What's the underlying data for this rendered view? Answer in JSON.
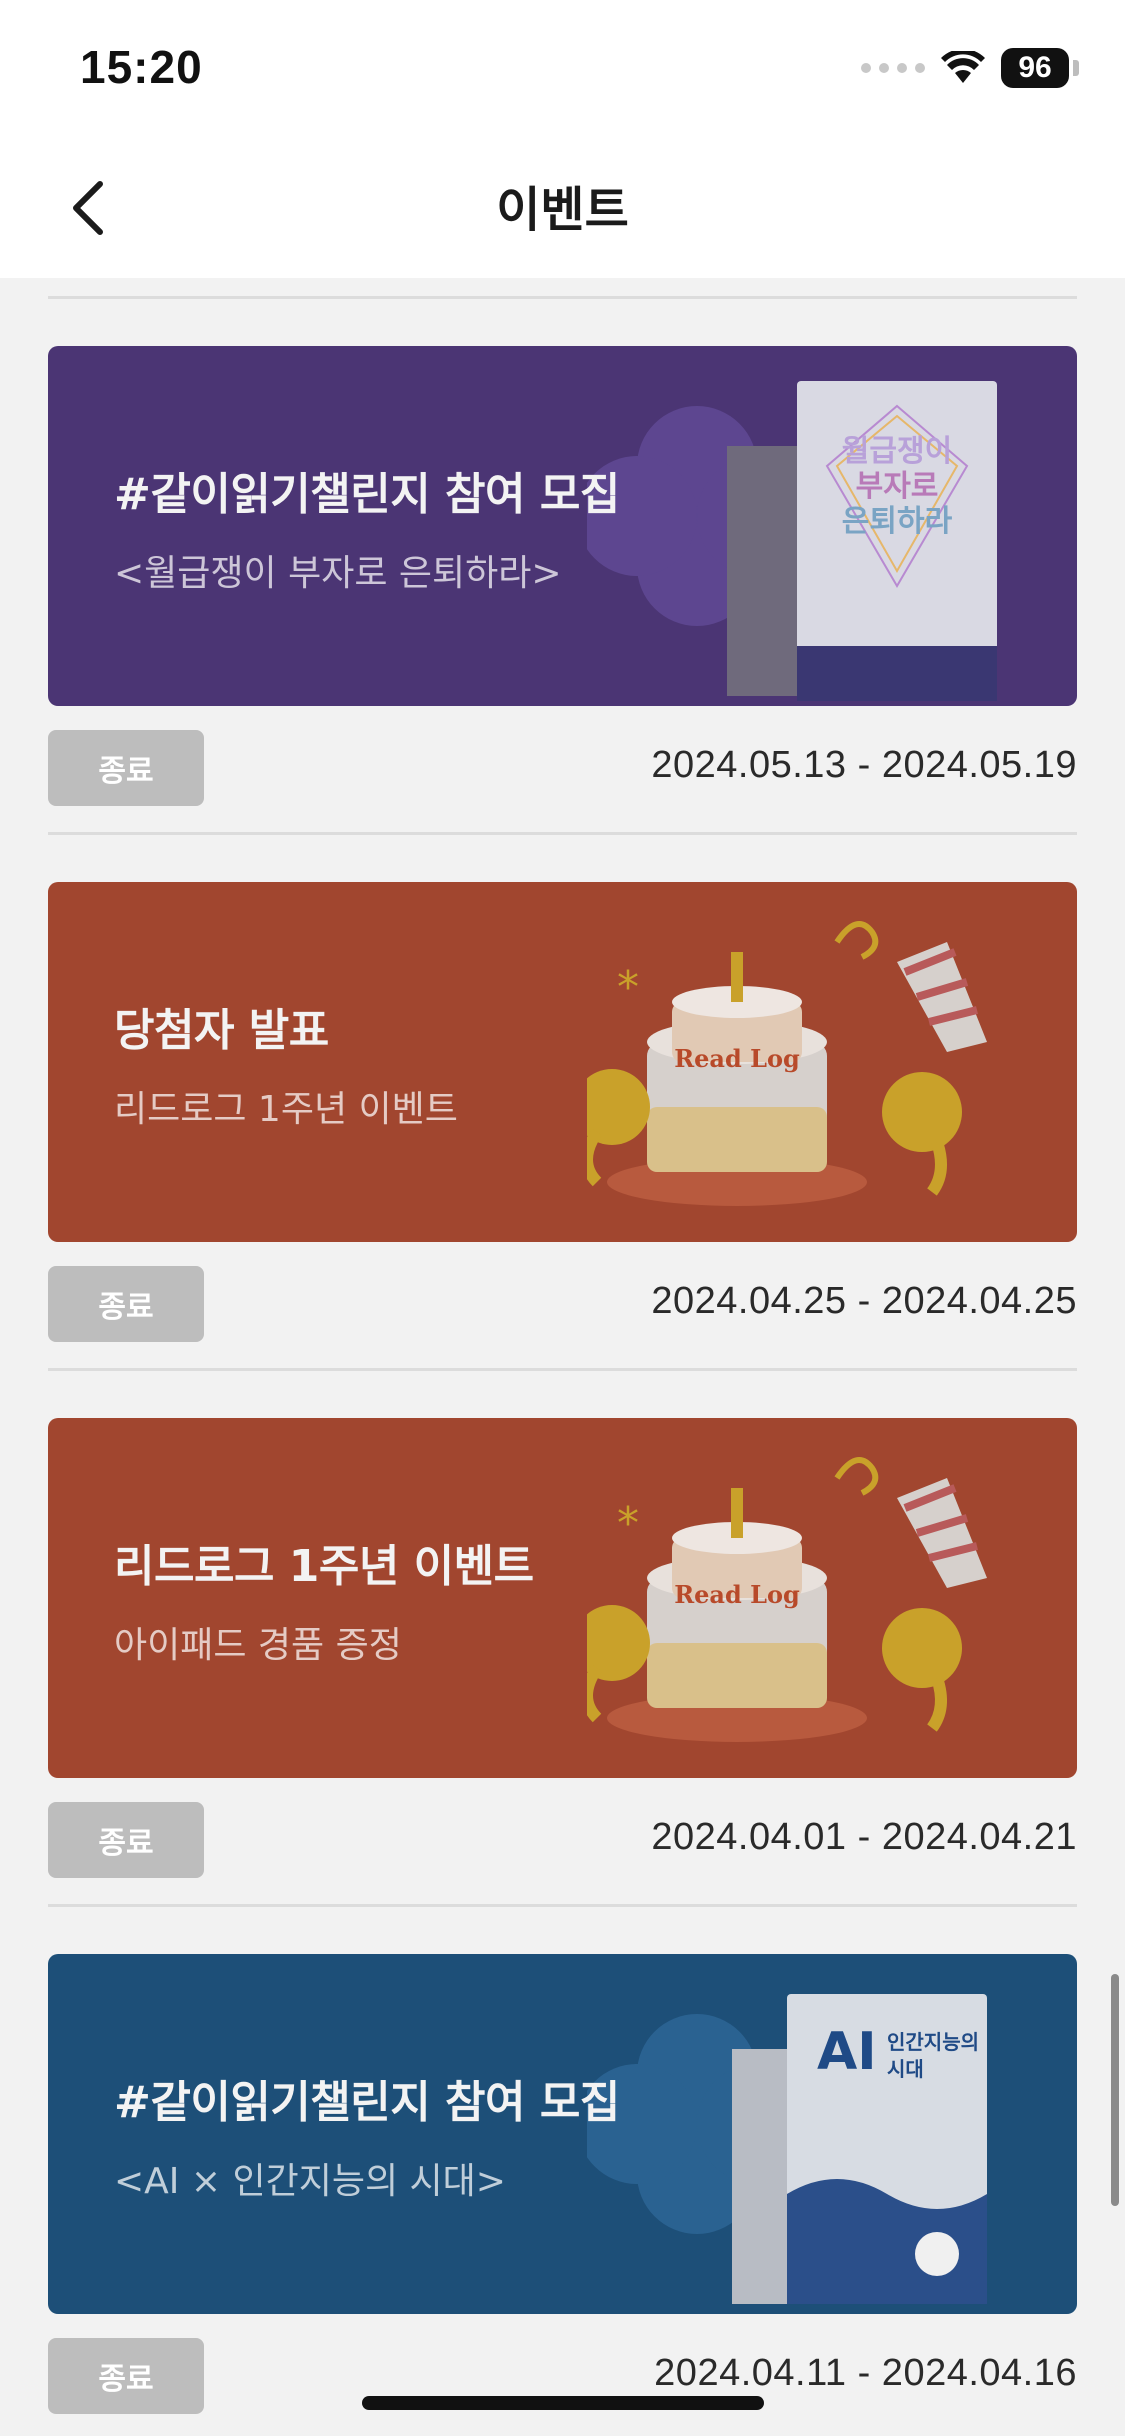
{
  "status_bar": {
    "time": "15:20",
    "battery": "96"
  },
  "nav": {
    "title": "이벤트"
  },
  "events": [
    {
      "title": "#같이읽기챌린지 참여 모집",
      "subtitle": "<월급쟁이 부자로 은퇴하라>",
      "status": "종료",
      "date_range": "2024.05.13 - 2024.05.19",
      "bg": "#4b3574",
      "art": "book-cover-purple",
      "book_title_lines": [
        "월급쟁이",
        "부자로",
        "은퇴하라"
      ]
    },
    {
      "title": "당첨자 발표",
      "subtitle": "리드로그 1주년 이벤트",
      "status": "종료",
      "date_range": "2024.04.25 - 2024.04.25",
      "bg": "#a1462f",
      "art": "birthday-cake",
      "cake_text": "Read Log"
    },
    {
      "title": "리드로그 1주년 이벤트",
      "subtitle": "아이패드 경품 증정",
      "status": "종료",
      "date_range": "2024.04.01 - 2024.04.21",
      "bg": "#a1462f",
      "art": "birthday-cake",
      "cake_text": "Read Log"
    },
    {
      "title": "#같이읽기챌린지 참여 모집",
      "subtitle": "<AI × 인간지능의 시대>",
      "status": "종료",
      "date_range": "2024.04.11 - 2024.04.16",
      "bg": "#1d4f78",
      "art": "book-cover-blue",
      "book_title_lines": [
        "AI",
        "인간지능의",
        "시대"
      ]
    }
  ]
}
